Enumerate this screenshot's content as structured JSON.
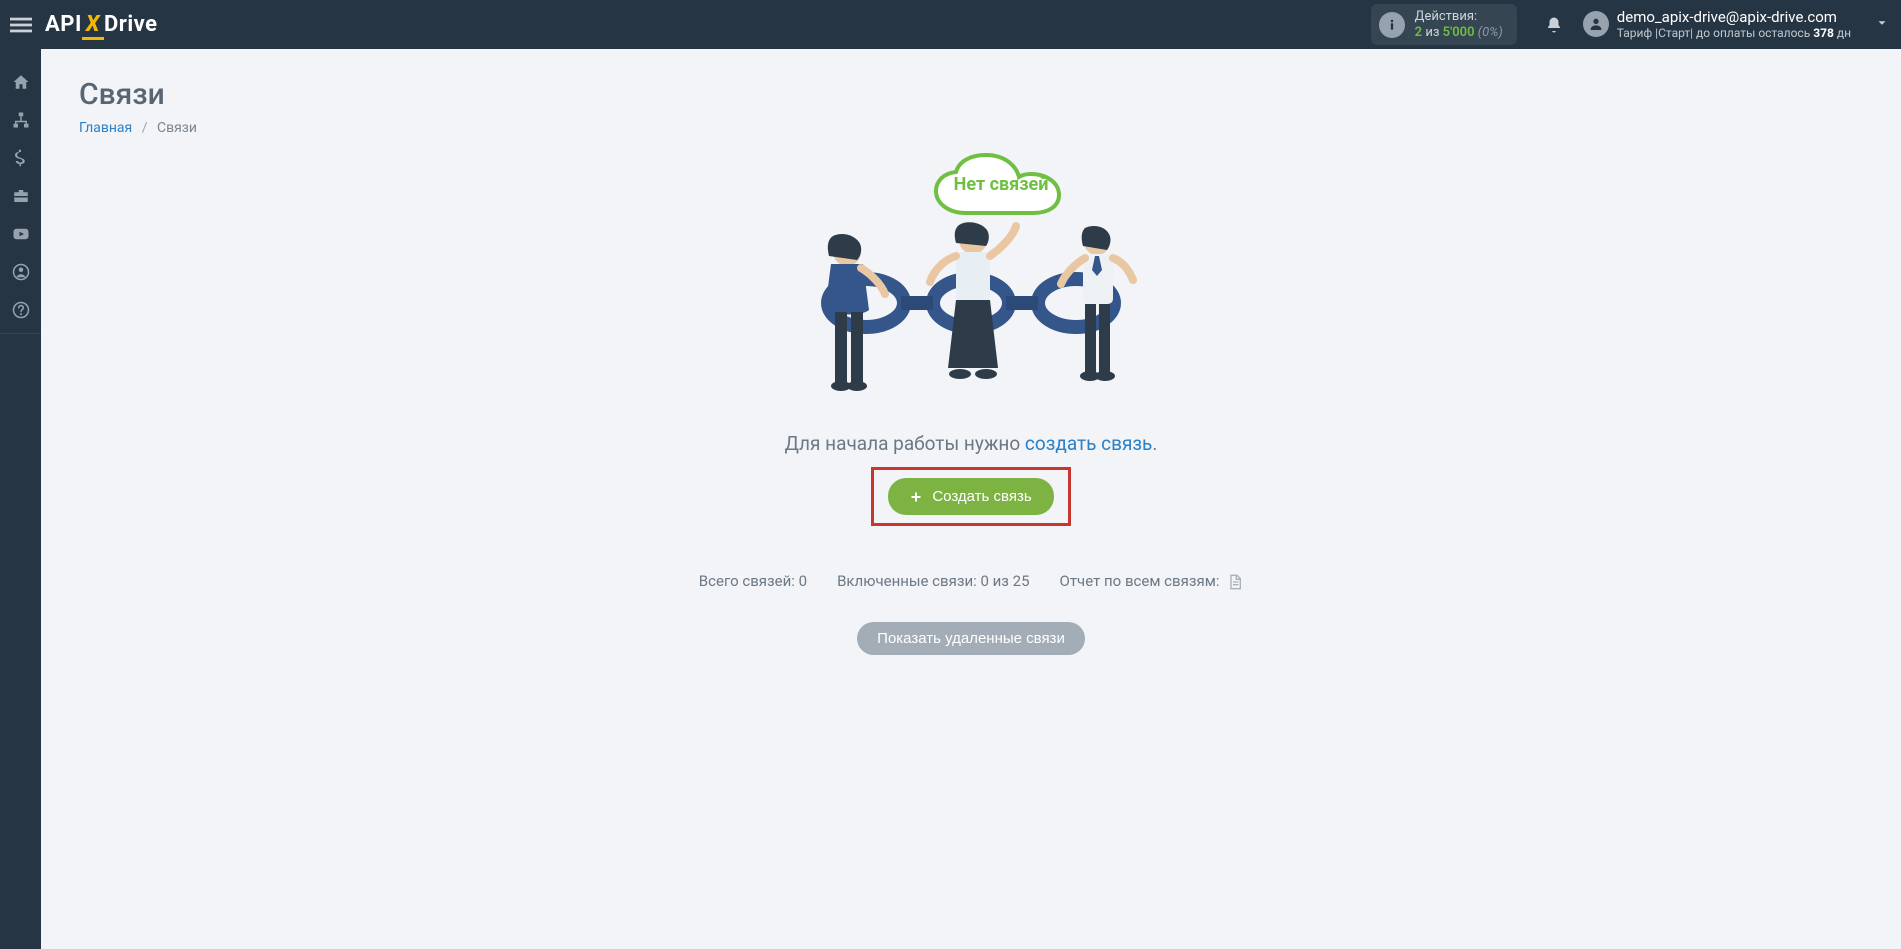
{
  "header": {
    "logo_pre": "API",
    "logo_x": "X",
    "logo_post": "Drive",
    "actions": {
      "label": "Действия:",
      "used": "2",
      "sep": " из ",
      "limit": "5'000",
      "pct": "(0%)"
    },
    "user": {
      "email": "demo_apix-drive@apix-drive.com",
      "plan_prefix": "Тариф |Старт| до оплаты осталось ",
      "plan_days": "378",
      "plan_suffix": " дн"
    }
  },
  "page": {
    "title": "Связи",
    "breadcrumb_home": "Главная",
    "breadcrumb_current": "Связи"
  },
  "empty": {
    "cloud_text": "Нет связей",
    "hint_prefix": "Для начала работы нужно ",
    "hint_link": "создать связь",
    "hint_suffix": ".",
    "create_button": "Создать связь"
  },
  "stats": {
    "total_label": "Всего связей:",
    "total_value": "0",
    "enabled_label": "Включенные связи:",
    "enabled_value": "0 из 25",
    "report_label": "Отчет по всем связям:"
  },
  "buttons": {
    "show_deleted": "Показать удаленные связи"
  }
}
